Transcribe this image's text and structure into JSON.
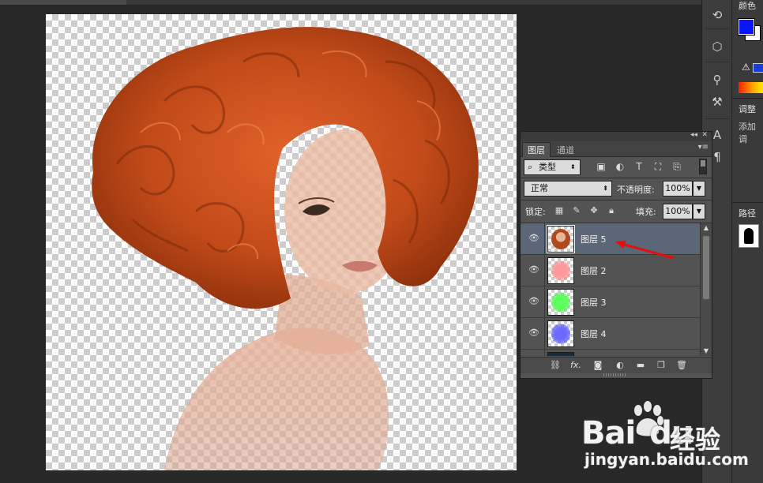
{
  "dock_right": {
    "color_title": "颜色",
    "adjust_title": "调整",
    "adjust_add": "添加调",
    "paths_title": "路径"
  },
  "layers_panel": {
    "tabs": [
      {
        "label": "图层",
        "active": true
      },
      {
        "label": "通道",
        "active": false
      }
    ],
    "filter_kind": "类型",
    "blend_mode": "正常",
    "opacity_label": "不透明度:",
    "opacity_value": "100%",
    "lock_label": "锁定:",
    "fill_label": "填充:",
    "fill_value": "100%",
    "layers": [
      {
        "name": "图层 5",
        "selected": true,
        "tint": "#b04a1e"
      },
      {
        "name": "图层 2",
        "selected": false,
        "tint": "#ff7a7a"
      },
      {
        "name": "图层 3",
        "selected": false,
        "tint": "#3cf03c"
      },
      {
        "name": "图层 4",
        "selected": false,
        "tint": "#3a3af0"
      }
    ],
    "bottom_icons": [
      "link-icon",
      "fx-icon",
      "mask-icon",
      "adjustment-icon",
      "folder-icon",
      "new-layer-icon",
      "trash-icon"
    ],
    "fx_label": "fx."
  },
  "colors": {
    "foreground": "#0a14ff",
    "background": "#ffffff",
    "selection": "#5b6776",
    "annotation_arrow": "#e01010"
  },
  "watermark": {
    "brand": "Bai",
    "brand_tail": "du",
    "product": "经验",
    "url": "jingyan.baidu.com"
  }
}
